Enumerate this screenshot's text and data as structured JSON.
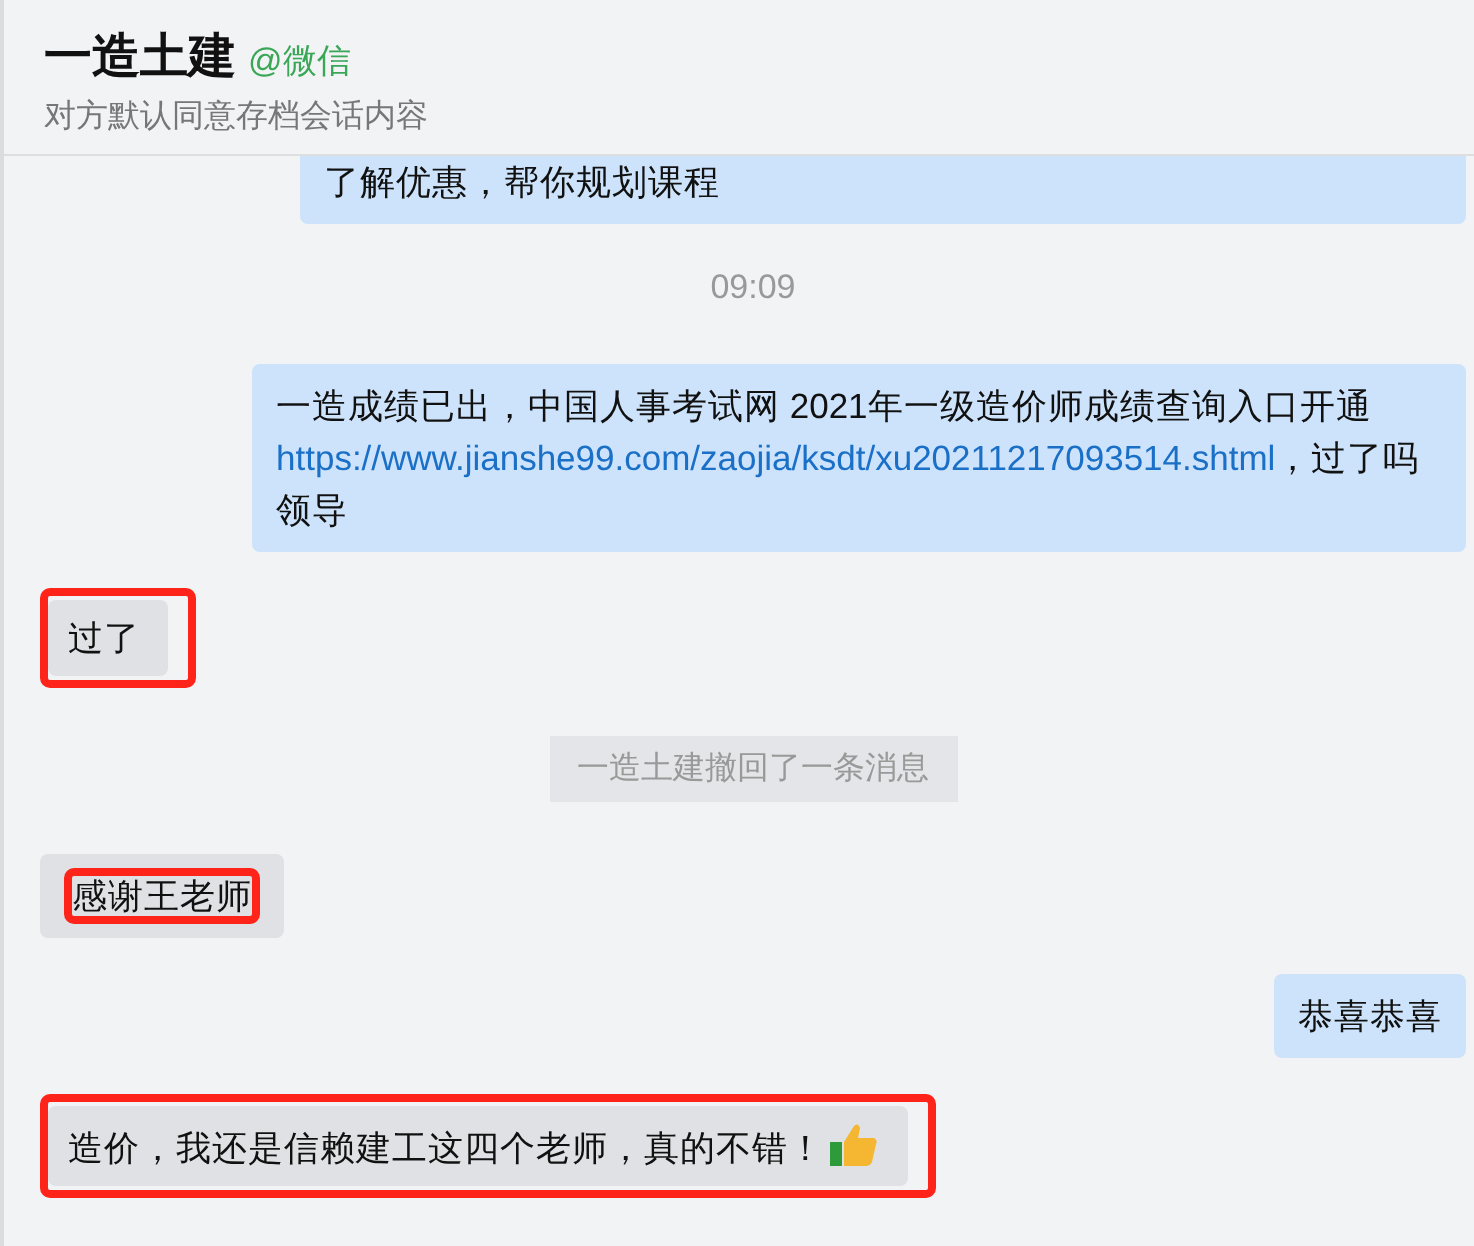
{
  "header": {
    "title": "一造土建",
    "source": "@微信",
    "subtitle": "对方默认同意存档会话内容"
  },
  "messages": [
    {
      "kind": "sent",
      "parts": [
        {
          "text": "了解优惠，帮你规划课程"
        }
      ]
    },
    {
      "kind": "time",
      "text": "09:09"
    },
    {
      "kind": "sent",
      "parts": [
        {
          "text": "一造成绩已出，中国人事考试网 2021年一级造价师成绩查询入口开通 "
        },
        {
          "text": "https://www.jianshe99.com/zaojia/ksdt/xu20211217093514.shtml",
          "kind": "link"
        },
        {
          "text": "，过了吗领导"
        }
      ]
    },
    {
      "kind": "received",
      "parts": [
        {
          "text": "过了"
        }
      ],
      "highlighted": true,
      "highlight_inner": false
    },
    {
      "kind": "notice",
      "text": "一造土建撤回了一条消息"
    },
    {
      "kind": "received",
      "parts": [
        {
          "text": "感谢王老师"
        }
      ],
      "highlighted": true,
      "highlight_inner": true
    },
    {
      "kind": "sent",
      "parts": [
        {
          "text": "恭喜恭喜"
        }
      ]
    },
    {
      "kind": "received",
      "parts": [
        {
          "text": "造价，我还是信赖建工这四个老师，真的不错！"
        }
      ],
      "highlighted": true,
      "highlight_inner": false,
      "thumbs_up": true
    }
  ]
}
